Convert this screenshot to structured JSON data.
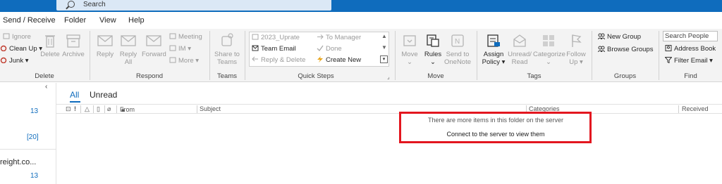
{
  "search": {
    "placeholder": "Search"
  },
  "menu": {
    "tabs": [
      "Send / Receive",
      "Folder",
      "View",
      "Help"
    ]
  },
  "ribbon": {
    "delete_group": {
      "label": "Delete",
      "ignore": "Ignore",
      "cleanup": "Clean Up",
      "junk": "Junk",
      "delete": "Delete",
      "archive": "Archive"
    },
    "respond_group": {
      "label": "Respond",
      "reply": "Reply",
      "reply_all_1": "Reply",
      "reply_all_2": "All",
      "forward": "Forward",
      "meeting": "Meeting",
      "im": "IM",
      "more": "More"
    },
    "teams_group": {
      "label": "Teams",
      "share_1": "Share to",
      "share_2": "Teams"
    },
    "quicksteps_group": {
      "label": "Quick Steps",
      "items": [
        "2023_Uprate",
        "Team Email",
        "Reply & Delete",
        "To Manager",
        "Done",
        "Create New"
      ]
    },
    "move_group": {
      "label": "Move",
      "move": "Move",
      "rules": "Rules",
      "onenote_1": "Send to",
      "onenote_2": "OneNote"
    },
    "tags_group": {
      "label": "Tags",
      "assign_1": "Assign",
      "assign_2": "Policy",
      "unread_1": "Unread/",
      "unread_2": "Read",
      "categorize": "Categorize",
      "follow_1": "Follow",
      "follow_2": "Up"
    },
    "groups_group": {
      "label": "Groups",
      "new_group": "New Group",
      "browse_groups": "Browse Groups"
    },
    "find_group": {
      "label": "Find",
      "search_people": "Search People",
      "address_book": "Address Book",
      "filter_email": "Filter Email"
    }
  },
  "folders": {
    "counts": [
      "13",
      "[20]",
      "13"
    ],
    "truncated_name": "reight.co..."
  },
  "list": {
    "filters": {
      "all": "All",
      "unread": "Unread"
    },
    "columns": {
      "from": "From",
      "subject": "Subject",
      "categories": "Categories",
      "received": "Received"
    },
    "notice_line1": "There are more items in this folder on the server",
    "notice_line2": "Connect to the server to view them"
  },
  "colors": {
    "accent": "#0f6cbd",
    "highlight_box": "#e3161f"
  }
}
